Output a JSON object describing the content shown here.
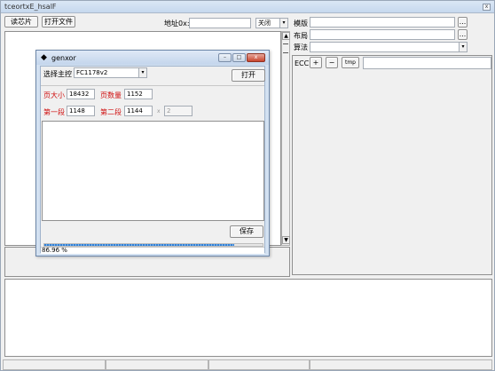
{
  "window": {
    "title": "tceortxE_hsalF",
    "close_glyph": "x"
  },
  "toolbar": {
    "read_chip": "读芯片",
    "open_file": "打开文件",
    "address_label": "地址0x:",
    "address_value": "",
    "mode_value": "关闭",
    "arrow": "▾"
  },
  "right_panel": {
    "template_label": "模版",
    "template_value": "",
    "layout_label": "布局",
    "layout_value": "",
    "algorithm_label": "算法",
    "algorithm_value": "",
    "browse": "...",
    "ecc_label": "ECC",
    "plus": "+",
    "minus": "−",
    "tmp": "tmp",
    "ecc_value": ""
  },
  "dialog": {
    "title": "genxor",
    "controller_label": "选择主控",
    "controller_value": "FC1178v2",
    "open_button": "打开",
    "page_size_label": "页大小",
    "page_size_value": "18432",
    "page_count_label": "页数量",
    "page_count_value": "1152",
    "first_seg_label": "第一段",
    "first_seg_value": "1148",
    "second_seg_label": "第二段",
    "second_seg_value": "1144",
    "x_sep": "x",
    "third_value": "2",
    "save_button": "保存",
    "progress_text": "86.96 %",
    "progress_fraction": 0.8696,
    "cap_min": "–",
    "cap_max": "□",
    "cap_close": "x"
  },
  "colors": {
    "label_red": "#d01010",
    "progress": "#2f7fd6"
  }
}
